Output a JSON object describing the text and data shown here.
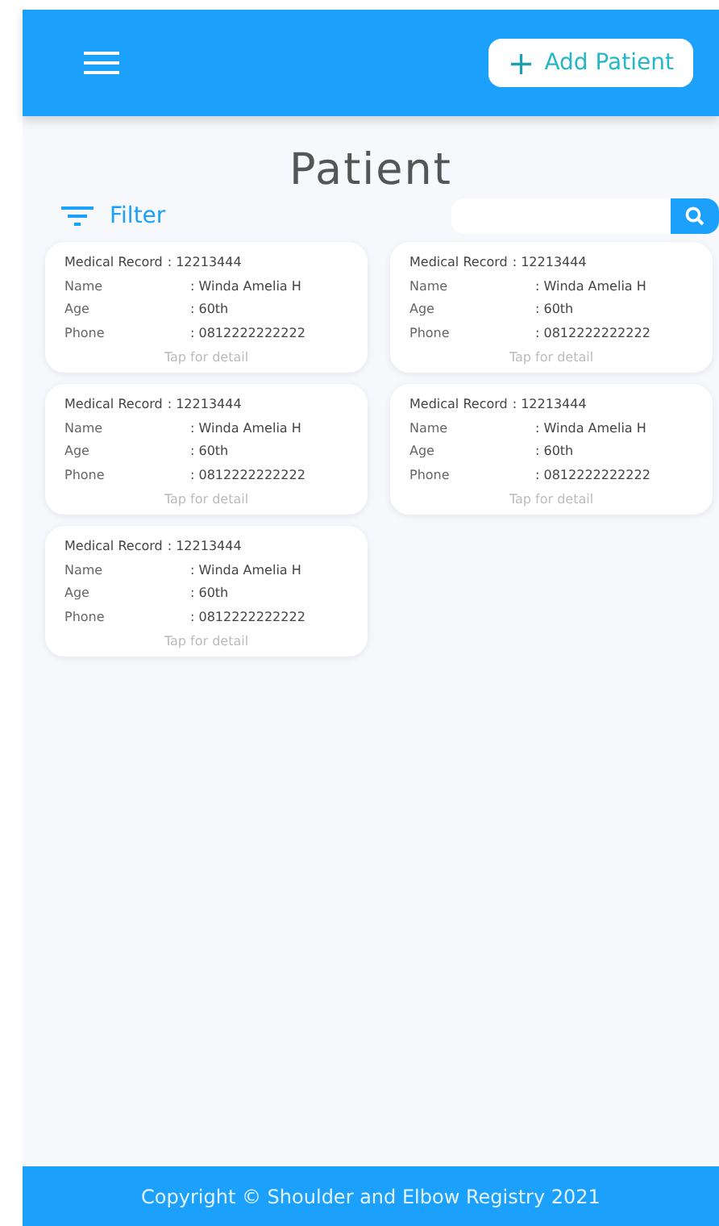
{
  "header": {
    "add_button": {
      "icon": "+",
      "label": "Add Patient"
    }
  },
  "title": "Patient",
  "filter": {
    "label": "Filter"
  },
  "patients": [
    {
      "fields": [
        {
          "kind": "inline",
          "label": "Medical Record",
          "value": ": 12213444"
        },
        {
          "kind": "pair",
          "label": "Name",
          "value": ": Winda Amelia H"
        },
        {
          "kind": "pair",
          "label": "Age",
          "value": ": 60th"
        },
        {
          "kind": "pair",
          "label": "Phone",
          "value": ": 0812222222222"
        }
      ],
      "hint": "Tap for detail"
    },
    {
      "fields": [
        {
          "kind": "inline",
          "label": "Medical Record",
          "value": ": 12213444"
        },
        {
          "kind": "pair",
          "label": "Name",
          "value": ": Winda Amelia H"
        },
        {
          "kind": "pair",
          "label": "Age",
          "value": ": 60th"
        },
        {
          "kind": "pair",
          "label": "Phone",
          "value": ": 0812222222222"
        }
      ],
      "hint": "Tap for detail"
    },
    {
      "fields": [
        {
          "kind": "inline",
          "label": "Medical Record",
          "value": ": 12213444"
        },
        {
          "kind": "pair",
          "label": "Name",
          "value": ": Winda Amelia H"
        },
        {
          "kind": "pair",
          "label": "Age",
          "value": ": 60th"
        },
        {
          "kind": "pair",
          "label": "Phone",
          "value": ": 0812222222222"
        }
      ],
      "hint": "Tap for detail"
    },
    {
      "fields": [
        {
          "kind": "inline",
          "label": "Medical Record",
          "value": ": 12213444"
        },
        {
          "kind": "pair",
          "label": "Name",
          "value": ": Winda Amelia H"
        },
        {
          "kind": "pair",
          "label": "Age",
          "value": ": 60th"
        },
        {
          "kind": "pair",
          "label": "Phone",
          "value": ": 0812222222222"
        }
      ],
      "hint": "Tap for detail"
    },
    {
      "fields": [
        {
          "kind": "inline",
          "label": "Medical Record",
          "value": ": 12213444"
        },
        {
          "kind": "pair",
          "label": "Name",
          "value": ": Winda Amelia H"
        },
        {
          "kind": "pair",
          "label": "Age",
          "value": ": 60th"
        },
        {
          "kind": "pair",
          "label": "Phone",
          "value": ": 0812222222222"
        }
      ],
      "hint": "Tap for detail"
    }
  ],
  "footer": {
    "text": "Copyright © Shoulder and Elbow Registry 2021"
  }
}
